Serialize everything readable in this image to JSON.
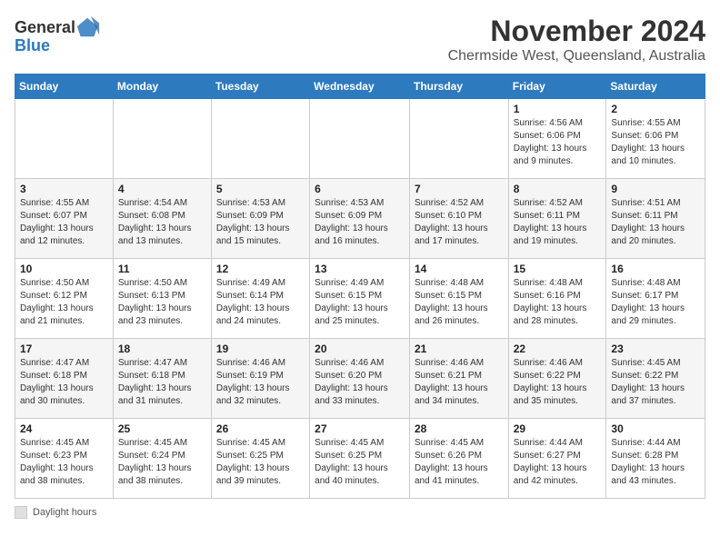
{
  "logo": {
    "general": "General",
    "blue": "Blue"
  },
  "title": "November 2024",
  "subtitle": "Chermside West, Queensland, Australia",
  "weekdays": [
    "Sunday",
    "Monday",
    "Tuesday",
    "Wednesday",
    "Thursday",
    "Friday",
    "Saturday"
  ],
  "legend_label": "Daylight hours",
  "weeks": [
    [
      {
        "day": "",
        "sunrise": "",
        "sunset": "",
        "daylight": ""
      },
      {
        "day": "",
        "sunrise": "",
        "sunset": "",
        "daylight": ""
      },
      {
        "day": "",
        "sunrise": "",
        "sunset": "",
        "daylight": ""
      },
      {
        "day": "",
        "sunrise": "",
        "sunset": "",
        "daylight": ""
      },
      {
        "day": "",
        "sunrise": "",
        "sunset": "",
        "daylight": ""
      },
      {
        "day": "1",
        "sunrise": "Sunrise: 4:56 AM",
        "sunset": "Sunset: 6:06 PM",
        "daylight": "Daylight: 13 hours and 9 minutes."
      },
      {
        "day": "2",
        "sunrise": "Sunrise: 4:55 AM",
        "sunset": "Sunset: 6:06 PM",
        "daylight": "Daylight: 13 hours and 10 minutes."
      }
    ],
    [
      {
        "day": "3",
        "sunrise": "Sunrise: 4:55 AM",
        "sunset": "Sunset: 6:07 PM",
        "daylight": "Daylight: 13 hours and 12 minutes."
      },
      {
        "day": "4",
        "sunrise": "Sunrise: 4:54 AM",
        "sunset": "Sunset: 6:08 PM",
        "daylight": "Daylight: 13 hours and 13 minutes."
      },
      {
        "day": "5",
        "sunrise": "Sunrise: 4:53 AM",
        "sunset": "Sunset: 6:09 PM",
        "daylight": "Daylight: 13 hours and 15 minutes."
      },
      {
        "day": "6",
        "sunrise": "Sunrise: 4:53 AM",
        "sunset": "Sunset: 6:09 PM",
        "daylight": "Daylight: 13 hours and 16 minutes."
      },
      {
        "day": "7",
        "sunrise": "Sunrise: 4:52 AM",
        "sunset": "Sunset: 6:10 PM",
        "daylight": "Daylight: 13 hours and 17 minutes."
      },
      {
        "day": "8",
        "sunrise": "Sunrise: 4:52 AM",
        "sunset": "Sunset: 6:11 PM",
        "daylight": "Daylight: 13 hours and 19 minutes."
      },
      {
        "day": "9",
        "sunrise": "Sunrise: 4:51 AM",
        "sunset": "Sunset: 6:11 PM",
        "daylight": "Daylight: 13 hours and 20 minutes."
      }
    ],
    [
      {
        "day": "10",
        "sunrise": "Sunrise: 4:50 AM",
        "sunset": "Sunset: 6:12 PM",
        "daylight": "Daylight: 13 hours and 21 minutes."
      },
      {
        "day": "11",
        "sunrise": "Sunrise: 4:50 AM",
        "sunset": "Sunset: 6:13 PM",
        "daylight": "Daylight: 13 hours and 23 minutes."
      },
      {
        "day": "12",
        "sunrise": "Sunrise: 4:49 AM",
        "sunset": "Sunset: 6:14 PM",
        "daylight": "Daylight: 13 hours and 24 minutes."
      },
      {
        "day": "13",
        "sunrise": "Sunrise: 4:49 AM",
        "sunset": "Sunset: 6:15 PM",
        "daylight": "Daylight: 13 hours and 25 minutes."
      },
      {
        "day": "14",
        "sunrise": "Sunrise: 4:48 AM",
        "sunset": "Sunset: 6:15 PM",
        "daylight": "Daylight: 13 hours and 26 minutes."
      },
      {
        "day": "15",
        "sunrise": "Sunrise: 4:48 AM",
        "sunset": "Sunset: 6:16 PM",
        "daylight": "Daylight: 13 hours and 28 minutes."
      },
      {
        "day": "16",
        "sunrise": "Sunrise: 4:48 AM",
        "sunset": "Sunset: 6:17 PM",
        "daylight": "Daylight: 13 hours and 29 minutes."
      }
    ],
    [
      {
        "day": "17",
        "sunrise": "Sunrise: 4:47 AM",
        "sunset": "Sunset: 6:18 PM",
        "daylight": "Daylight: 13 hours and 30 minutes."
      },
      {
        "day": "18",
        "sunrise": "Sunrise: 4:47 AM",
        "sunset": "Sunset: 6:18 PM",
        "daylight": "Daylight: 13 hours and 31 minutes."
      },
      {
        "day": "19",
        "sunrise": "Sunrise: 4:46 AM",
        "sunset": "Sunset: 6:19 PM",
        "daylight": "Daylight: 13 hours and 32 minutes."
      },
      {
        "day": "20",
        "sunrise": "Sunrise: 4:46 AM",
        "sunset": "Sunset: 6:20 PM",
        "daylight": "Daylight: 13 hours and 33 minutes."
      },
      {
        "day": "21",
        "sunrise": "Sunrise: 4:46 AM",
        "sunset": "Sunset: 6:21 PM",
        "daylight": "Daylight: 13 hours and 34 minutes."
      },
      {
        "day": "22",
        "sunrise": "Sunrise: 4:46 AM",
        "sunset": "Sunset: 6:22 PM",
        "daylight": "Daylight: 13 hours and 35 minutes."
      },
      {
        "day": "23",
        "sunrise": "Sunrise: 4:45 AM",
        "sunset": "Sunset: 6:22 PM",
        "daylight": "Daylight: 13 hours and 37 minutes."
      }
    ],
    [
      {
        "day": "24",
        "sunrise": "Sunrise: 4:45 AM",
        "sunset": "Sunset: 6:23 PM",
        "daylight": "Daylight: 13 hours and 38 minutes."
      },
      {
        "day": "25",
        "sunrise": "Sunrise: 4:45 AM",
        "sunset": "Sunset: 6:24 PM",
        "daylight": "Daylight: 13 hours and 38 minutes."
      },
      {
        "day": "26",
        "sunrise": "Sunrise: 4:45 AM",
        "sunset": "Sunset: 6:25 PM",
        "daylight": "Daylight: 13 hours and 39 minutes."
      },
      {
        "day": "27",
        "sunrise": "Sunrise: 4:45 AM",
        "sunset": "Sunset: 6:25 PM",
        "daylight": "Daylight: 13 hours and 40 minutes."
      },
      {
        "day": "28",
        "sunrise": "Sunrise: 4:45 AM",
        "sunset": "Sunset: 6:26 PM",
        "daylight": "Daylight: 13 hours and 41 minutes."
      },
      {
        "day": "29",
        "sunrise": "Sunrise: 4:44 AM",
        "sunset": "Sunset: 6:27 PM",
        "daylight": "Daylight: 13 hours and 42 minutes."
      },
      {
        "day": "30",
        "sunrise": "Sunrise: 4:44 AM",
        "sunset": "Sunset: 6:28 PM",
        "daylight": "Daylight: 13 hours and 43 minutes."
      }
    ]
  ]
}
